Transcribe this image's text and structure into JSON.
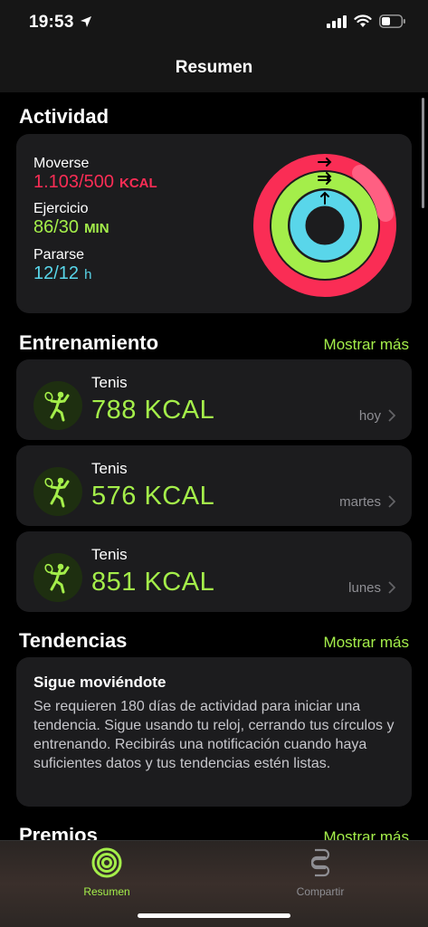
{
  "status_bar": {
    "time": "19:53"
  },
  "nav": {
    "title": "Resumen"
  },
  "activity": {
    "section_title": "Actividad",
    "move": {
      "label": "Moverse",
      "value": "1.103/500",
      "unit": "KCAL"
    },
    "exercise": {
      "label": "Ejercicio",
      "value": "86/30",
      "unit": "MIN"
    },
    "stand": {
      "label": "Pararse",
      "value": "12/12",
      "unit": "h"
    },
    "rings": {
      "move_fraction": 2.206,
      "exercise_fraction": 2.867,
      "stand_fraction": 1.0
    }
  },
  "workouts": {
    "section_title": "Entrenamiento",
    "more_label": "Mostrar más",
    "items": [
      {
        "name": "Tenis",
        "kcal": "788 KCAL",
        "day": "hoy"
      },
      {
        "name": "Tenis",
        "kcal": "576 KCAL",
        "day": "martes"
      },
      {
        "name": "Tenis",
        "kcal": "851 KCAL",
        "day": "lunes"
      }
    ]
  },
  "trends": {
    "section_title": "Tendencias",
    "more_label": "Mostrar más",
    "card_title": "Sigue moviéndote",
    "card_body": "Se requieren 180 días de actividad para iniciar una tendencia. Sigue usando tu reloj, cerrando tus círculos y entrenando. Recibirás una notificación cuando haya suficientes datos y tus tendencias estén listas."
  },
  "awards": {
    "section_title": "Premios",
    "more_label": "Mostrar más"
  },
  "tabs": [
    {
      "label": "Resumen",
      "icon": "activity-rings-icon",
      "active": true
    },
    {
      "label": "Compartir",
      "icon": "sharing-icon",
      "active": false
    }
  ],
  "colors": {
    "move": "#fa2d55",
    "exercise": "#a4ee4a",
    "stand": "#59d6ea",
    "accent": "#a4ee4a"
  }
}
